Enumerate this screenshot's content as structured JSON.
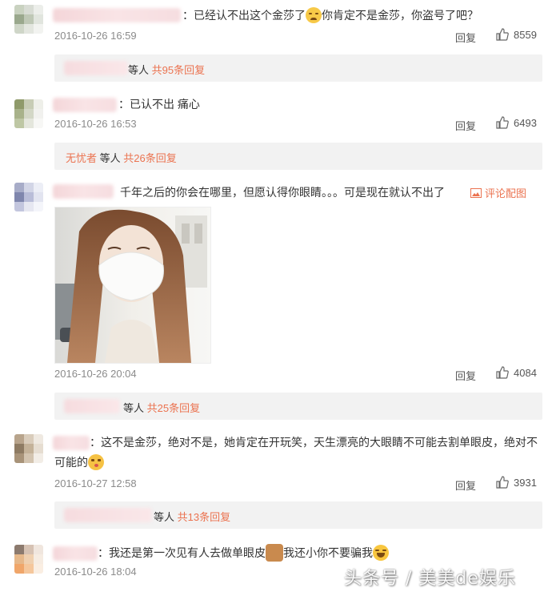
{
  "comments": [
    {
      "text_a": "：已经认不出这个金莎了",
      "text_b": "你肯定不是金莎，你盗号了吧？",
      "date": "2016-10-26 16:59",
      "reply_label": "回复",
      "likes": "8559",
      "thread": {
        "who": "等人",
        "count": "共95条回复"
      }
    },
    {
      "text_a": "：已认不出 痛心",
      "date": "2016-10-26 16:53",
      "reply_label": "回复",
      "likes": "6493",
      "thread": {
        "first_name": "无忧者",
        "who": "等人",
        "count": "共26条回复"
      }
    },
    {
      "text_a": "千年之后的你会在哪里，但愿认得你眼睛。。。可是现在就认不出了",
      "pic_link": "评论配图",
      "date": "2016-10-26 20:04",
      "reply_label": "回复",
      "likes": "4084",
      "thread": {
        "who": "等人",
        "count": "共25条回复"
      }
    },
    {
      "text_a": "：这不是金莎，绝对不是，她肯定在开玩笑，天生漂亮的大眼睛不可能去割单眼皮，绝对不",
      "text_b": "可能的",
      "date": "2016-10-27 12:58",
      "reply_label": "回复",
      "likes": "3931",
      "thread": {
        "who": "等人",
        "count": "共13条回复"
      }
    },
    {
      "text_a": "：我还是第一次见有人去做单眼皮",
      "text_b": "我还小你不要骗我",
      "date": "2016-10-26 18:04"
    }
  ],
  "icons": {
    "like": "thumbs-up-icon",
    "pic": "image-icon",
    "emoji": [
      "sad-face-emoji",
      "kiss-face-emoji",
      "dog-emoji",
      "laugh-tears-emoji"
    ]
  },
  "colors": {
    "accent": "#eb7350",
    "date": "#8b8b8b",
    "subbox": "#f2f2f2"
  },
  "watermark": "头条号 / 美美de娱乐"
}
